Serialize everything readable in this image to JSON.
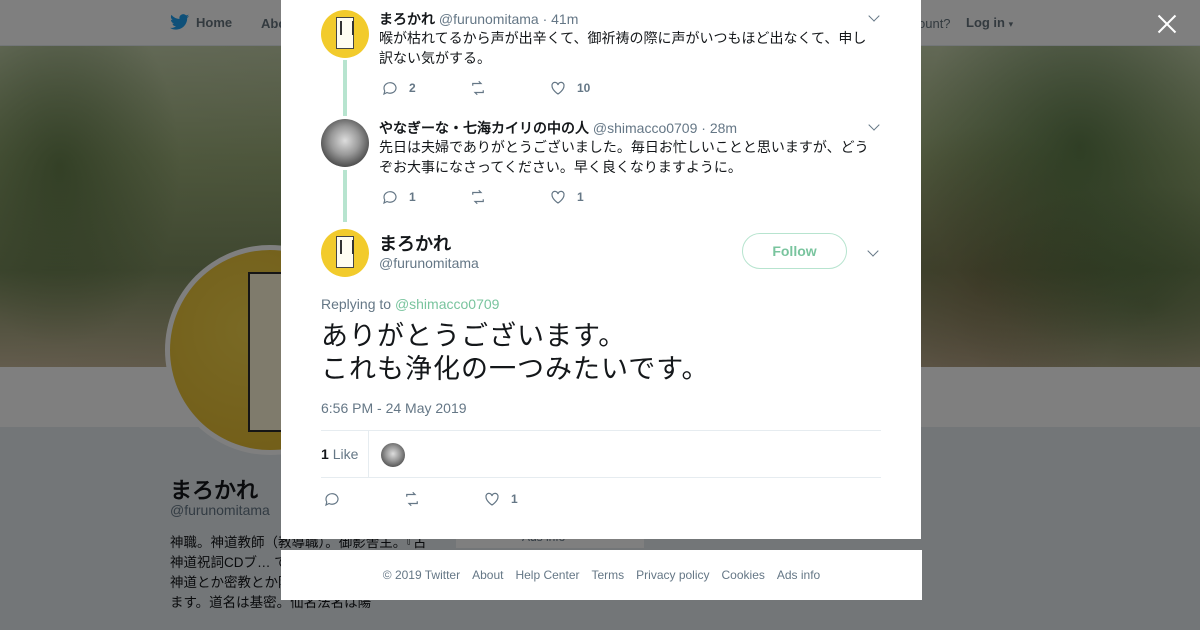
{
  "background": {
    "nav": {
      "home": "Home",
      "about": "Abo",
      "account": "ccount?",
      "login": "Log in"
    },
    "profile": {
      "name": "まろかれ",
      "handle": "@furunomitama",
      "bio": "神職。神道教師（教導職）。御影舎主。『古神道祝詞CDブ… で買えます。祝詞… す。神道とか密教とか陰陽道とか仙道に反応します。道名は基密。仙名法名は陽"
    },
    "ads_info": "Ads info"
  },
  "thread": [
    {
      "name": "まろかれ",
      "handle": "@furunomitama",
      "time": "· 41m",
      "text": "喉が枯れてるから声が出辛くて、御祈祷の際に声がいつもほど出なくて、申し訳ない気がする。",
      "replies": "2",
      "retweets": "",
      "likes": "10"
    },
    {
      "name": "やなぎーな・七海カイリの中の人",
      "handle": "@shimacco0709",
      "time": "· 28m",
      "text": "先日は夫婦でありがとうございました。毎日お忙しいことと思いますが、どうぞお大事になさってください。早く良くなりますように。",
      "replies": "1",
      "retweets": "",
      "likes": "1"
    }
  ],
  "main_tweet": {
    "name": "まろかれ",
    "handle": "@furunomitama",
    "follow_label": "Follow",
    "replying_prefix": "Replying to",
    "replying_to": "@shimacco0709",
    "line1": "ありがとうございます。",
    "line2": "これも浄化の一つみたいです。",
    "timestamp": "6:56 PM - 24 May 2019",
    "like_count": "1",
    "like_label": "Like",
    "action_likes": "1"
  },
  "footer": {
    "copyright": "© 2019 Twitter",
    "links": [
      "About",
      "Help Center",
      "Terms",
      "Privacy policy",
      "Cookies",
      "Ads info"
    ]
  },
  "colors": {
    "accent": "#79c49e",
    "thread_line": "#b7e4cf",
    "muted": "#657786",
    "twitter_blue": "#1da1f2"
  }
}
